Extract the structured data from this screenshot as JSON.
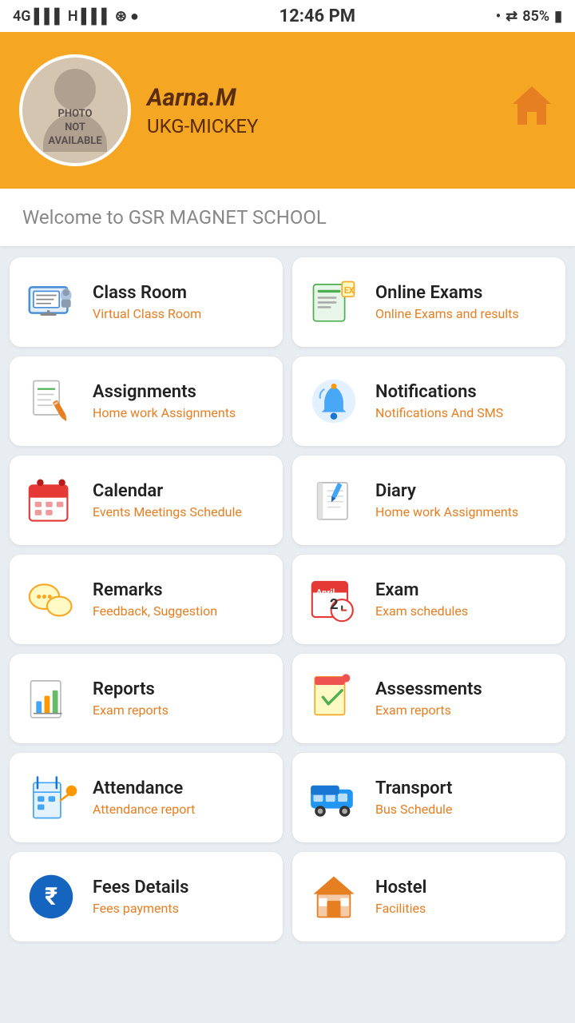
{
  "statusBar": {
    "left": "4G H",
    "time": "12:46 PM",
    "right": "85%"
  },
  "header": {
    "name": "Aarna.M",
    "class": "UKG-MICKEY",
    "avatar_text": "PHOTO\nNOT\nAVAILABLE",
    "home_icon": "🏠"
  },
  "welcome": {
    "text": "Welcome to GSR MAGNET SCHOOL"
  },
  "cards": [
    {
      "id": "classroom",
      "title": "Class Room",
      "subtitle": "Virtual Class Room",
      "icon": "classroom"
    },
    {
      "id": "online-exams",
      "title": "Online Exams",
      "subtitle": "Online Exams and results",
      "icon": "exam"
    },
    {
      "id": "assignments",
      "title": "Assignments",
      "subtitle": "Home work Assignments",
      "icon": "assignments"
    },
    {
      "id": "notifications",
      "title": "Notifications",
      "subtitle": "Notifications And SMS",
      "icon": "notifications"
    },
    {
      "id": "calendar",
      "title": "Calendar",
      "subtitle": "Events Meetings Schedule",
      "icon": "calendar"
    },
    {
      "id": "diary",
      "title": "Diary",
      "subtitle": "Home work Assignments",
      "icon": "diary"
    },
    {
      "id": "remarks",
      "title": "Remarks",
      "subtitle": "Feedback, Suggestion",
      "icon": "remarks"
    },
    {
      "id": "exam",
      "title": "Exam",
      "subtitle": "Exam schedules",
      "icon": "examschedule"
    },
    {
      "id": "reports",
      "title": "Reports",
      "subtitle": "Exam reports",
      "icon": "reports"
    },
    {
      "id": "assessments",
      "title": "Assessments",
      "subtitle": "Exam reports",
      "icon": "assessments"
    },
    {
      "id": "attendance",
      "title": "Attendance",
      "subtitle": "Attendance report",
      "icon": "attendance"
    },
    {
      "id": "transport",
      "title": "Transport",
      "subtitle": "Bus Schedule",
      "icon": "transport"
    },
    {
      "id": "fees",
      "title": "Fees Details",
      "subtitle": "Fees payments",
      "icon": "fees"
    },
    {
      "id": "hostel",
      "title": "Hostel",
      "subtitle": "Facilities",
      "icon": "hostel"
    }
  ]
}
